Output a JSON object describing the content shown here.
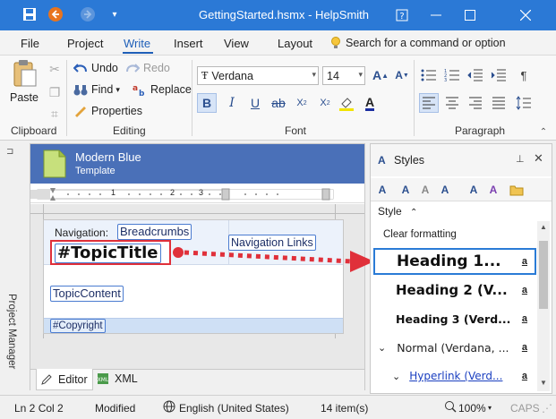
{
  "window": {
    "title": "GettingStarted.hsmx - HelpSmith"
  },
  "tabs": [
    "File",
    "Project",
    "Write",
    "Insert",
    "View",
    "Layout"
  ],
  "search": {
    "placeholder": "Search for a command or option"
  },
  "ribbon": {
    "paste": "Paste",
    "undo": "Undo",
    "redo": "Redo",
    "find": "Find",
    "replace": "Replace",
    "properties": "Properties",
    "font_name": "Verdana",
    "font_size": "14",
    "groups": {
      "clipboard": "Clipboard",
      "editing": "Editing",
      "font": "Font",
      "paragraph": "Paragraph"
    }
  },
  "project_manager": "Project Manager",
  "editor": {
    "template_name": "Modern Blue",
    "template_sub": "Template",
    "ruler": [
      "1",
      "2",
      "3"
    ],
    "nav_label": "Navigation:",
    "breadcrumbs": "Breadcrumbs",
    "nav_links": "Navigation Links",
    "topic_title": "#TopicTitle",
    "topic_content": "TopicContent",
    "copyright": "#Copyright",
    "tab_editor": "Editor",
    "tab_xml": "XML"
  },
  "styles_panel": {
    "title": "Styles",
    "column": "Style",
    "items": [
      {
        "label": "Clear formatting",
        "key": ""
      },
      {
        "label": "Heading 1...",
        "key": "a"
      },
      {
        "label": "Heading 2 (V...",
        "key": "a"
      },
      {
        "label": "Heading 3 (Verd...",
        "key": "a"
      },
      {
        "label": "Normal (Verdana, ...",
        "key": "a"
      },
      {
        "label": "Hyperlink (Verd...",
        "key": "a"
      }
    ]
  },
  "status": {
    "position": "Ln 2 Col 2",
    "state": "Modified",
    "language": "English (United States)",
    "items": "14 item(s)",
    "zoom": "100%",
    "caps": "CAPS"
  },
  "colors": {
    "titlebar": "#2b79d6",
    "accent": "#1f5fb8",
    "template": "#4a70b8",
    "arrow": "#e0303a"
  }
}
